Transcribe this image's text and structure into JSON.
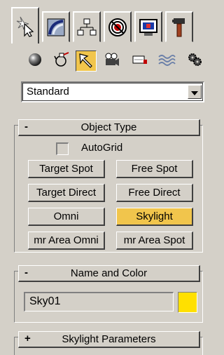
{
  "panel_tabs": [
    {
      "icon": "create-star-cursor-icon",
      "active": true
    },
    {
      "icon": "modify-curve-icon",
      "active": false
    },
    {
      "icon": "hierarchy-icon",
      "active": false
    },
    {
      "icon": "motion-icon",
      "active": false
    },
    {
      "icon": "display-monitor-icon",
      "active": false
    },
    {
      "icon": "utilities-hammer-icon",
      "active": false
    }
  ],
  "category_icons": [
    {
      "icon": "geometry-sphere-icon",
      "active": false
    },
    {
      "icon": "shapes-icon",
      "active": false
    },
    {
      "icon": "lights-icon",
      "active": true
    },
    {
      "icon": "cameras-icon",
      "active": false
    },
    {
      "icon": "helpers-icon",
      "active": false
    },
    {
      "icon": "space-warps-icon",
      "active": false
    },
    {
      "icon": "systems-icon",
      "active": false
    }
  ],
  "category_dropdown": {
    "value": "Standard"
  },
  "object_type": {
    "title": "Object Type",
    "sign": "-",
    "autogrid_label": "AutoGrid",
    "autogrid_checked": false,
    "buttons": [
      {
        "label": "Target Spot",
        "active": false
      },
      {
        "label": "Free Spot",
        "active": false
      },
      {
        "label": "Target Direct",
        "active": false
      },
      {
        "label": "Free Direct",
        "active": false
      },
      {
        "label": "Omni",
        "active": false
      },
      {
        "label": "Skylight",
        "active": true
      },
      {
        "label": "mr Area Omni",
        "active": false
      },
      {
        "label": "mr Area Spot",
        "active": false
      }
    ]
  },
  "name_and_color": {
    "title": "Name and Color",
    "sign": "-",
    "name_value": "Sky01",
    "color": "#ffe000"
  },
  "skylight_params": {
    "title": "Skylight Parameters",
    "sign": "+"
  },
  "colors": {
    "panel_bg": "#d4d0c8",
    "active_highlight": "#f1c54c"
  }
}
